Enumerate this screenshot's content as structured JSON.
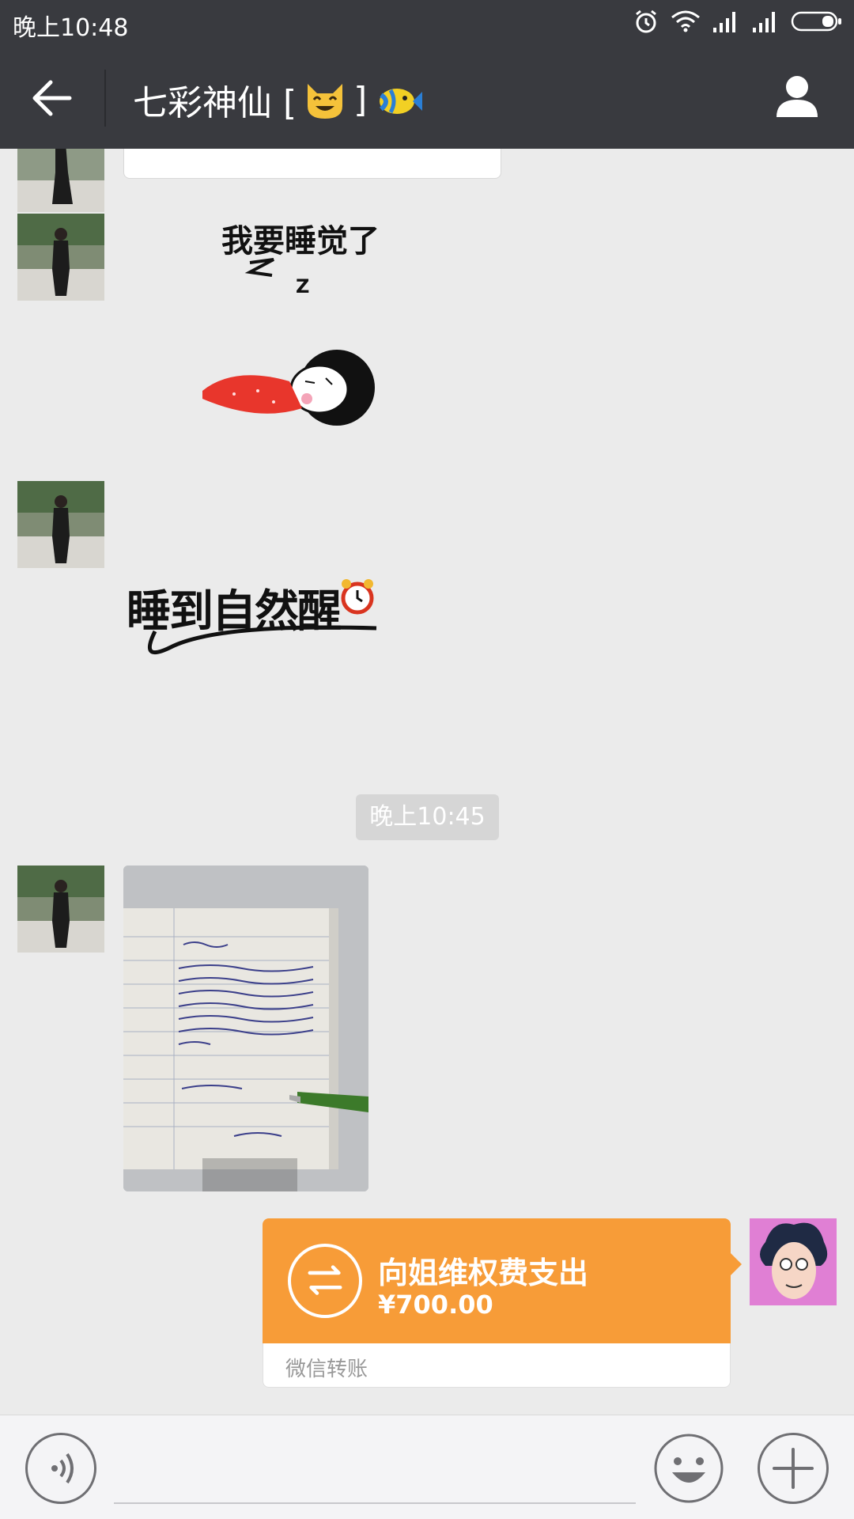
{
  "status_bar": {
    "time": "晚上10:48",
    "icons": [
      "alarm-icon",
      "wifi-icon",
      "signal-icon",
      "signal-icon",
      "battery-icon"
    ]
  },
  "header": {
    "title": "七彩神仙 [",
    "title_close": "]",
    "title_emojis": [
      "smiling-cat-emoji",
      "tropical-fish-emoji"
    ],
    "back_icon": "back-arrow-icon",
    "profile_icon": "person-icon"
  },
  "messages": {
    "sticker_1_text": "我要睡觉了",
    "sticker_1_zz": "Z",
    "sticker_2_text": "睡到自然醒",
    "timestamp": "晚上10:45",
    "photo_alt": "handwritten-note-photo",
    "transfer": {
      "title": "向姐维权费支出",
      "amount": "¥700.00",
      "source": "微信转账"
    }
  },
  "input_bar": {
    "voice_icon": "voice-icon",
    "emoji_icon": "emoji-icon",
    "plus_icon": "plus-icon"
  },
  "colors": {
    "header_bg": "#393a3f",
    "chat_bg": "#ebebeb",
    "transfer_orange": "#f79c38"
  }
}
